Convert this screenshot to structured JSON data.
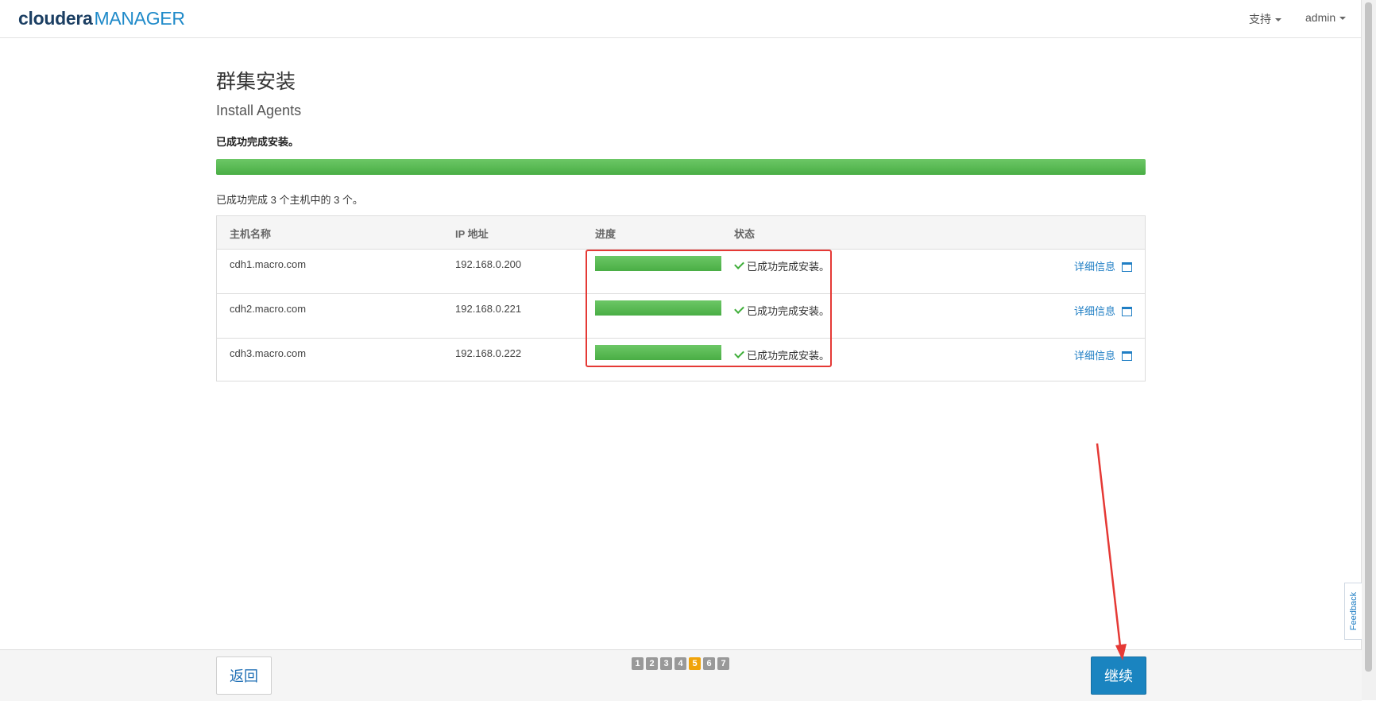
{
  "navbar": {
    "brand_primary": "cloudera",
    "brand_secondary": "MANAGER",
    "support_label": "支持",
    "user_label": "admin"
  },
  "page": {
    "title": "群集安装",
    "subtitle": "Install Agents",
    "status_message": "已成功完成安装。",
    "overall_progress_percent": 100,
    "summary": "已成功完成 3 个主机中的 3 个。"
  },
  "table": {
    "headers": {
      "host": "主机名称",
      "ip": "IP 地址",
      "progress": "进度",
      "status": "状态"
    },
    "rows": [
      {
        "host": "cdh1.macro.com",
        "ip": "192.168.0.200",
        "progress_percent": 100,
        "status": "已成功完成安装。",
        "details_label": "详细信息"
      },
      {
        "host": "cdh2.macro.com",
        "ip": "192.168.0.221",
        "progress_percent": 100,
        "status": "已成功完成安装。",
        "details_label": "详细信息"
      },
      {
        "host": "cdh3.macro.com",
        "ip": "192.168.0.222",
        "progress_percent": 100,
        "status": "已成功完成安装。",
        "details_label": "详细信息"
      }
    ]
  },
  "feedback": {
    "label": "Feedback"
  },
  "footer": {
    "back_label": "返回",
    "continue_label": "继续",
    "steps": [
      "1",
      "2",
      "3",
      "4",
      "5",
      "6",
      "7"
    ],
    "active_step": "5"
  },
  "icons": {
    "status_ok": "check-icon",
    "details": "window-icon",
    "caret": "caret-down-icon"
  },
  "colors": {
    "brand_dark": "#1c3f63",
    "brand_blue": "#1f8ac9",
    "progress_green": "#5cb85c",
    "primary_button": "#1a84c0",
    "active_step": "#f0a30a",
    "annotation_red": "#e53935"
  }
}
